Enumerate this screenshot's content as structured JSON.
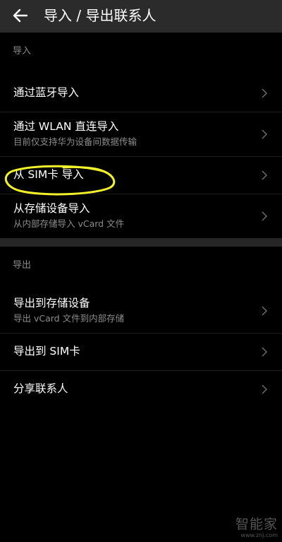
{
  "app_bar": {
    "back_icon": "arrow-left-icon",
    "title": "导入 / 导出联系人"
  },
  "sections": {
    "import": {
      "header": "导入",
      "items": [
        {
          "title": "通过蓝牙导入",
          "subtitle": ""
        },
        {
          "title": "通过 WLAN 直连导入",
          "subtitle": "目前仅支持华为设备间数据传输"
        },
        {
          "title": "从 SIM卡 导入",
          "subtitle": ""
        },
        {
          "title": "从存储设备导入",
          "subtitle": "从内部存储导入 vCard 文件"
        }
      ]
    },
    "export": {
      "header": "导出",
      "items": [
        {
          "title": "导出到存储设备",
          "subtitle": "导出 vCard 文件到内部存储"
        },
        {
          "title": "导出到 SIM卡",
          "subtitle": ""
        },
        {
          "title": "分享联系人",
          "subtitle": ""
        }
      ]
    }
  },
  "icons": {
    "row_chevron": "chevron-right-icon"
  },
  "annotation": {
    "highlight_color": "#f2f22a"
  },
  "colors": {
    "background": "#000000",
    "app_bar": "#2b2b2b",
    "secondary_text": "#8c8c8c",
    "divider": "#262626"
  },
  "watermark": {
    "logo_text": "智能家",
    "url": "www.znj.com"
  }
}
